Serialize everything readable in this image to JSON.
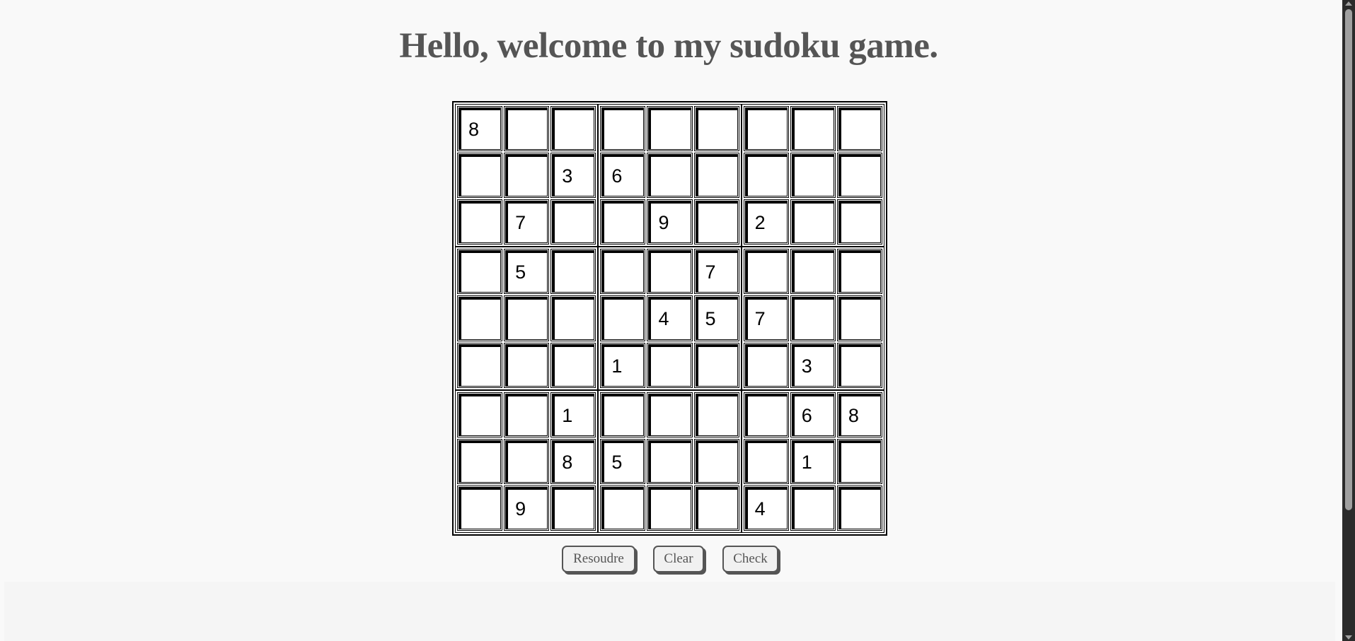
{
  "title": "Hello, welcome to my sudoku game.",
  "grid": [
    [
      "8",
      "",
      "",
      "",
      "",
      "",
      "",
      "",
      ""
    ],
    [
      "",
      "",
      "3",
      "6",
      "",
      "",
      "",
      "",
      ""
    ],
    [
      "",
      "7",
      "",
      "",
      "9",
      "",
      "2",
      "",
      ""
    ],
    [
      "",
      "5",
      "",
      "",
      "",
      "7",
      "",
      "",
      ""
    ],
    [
      "",
      "",
      "",
      "",
      "4",
      "5",
      "7",
      "",
      ""
    ],
    [
      "",
      "",
      "",
      "1",
      "",
      "",
      "",
      "3",
      ""
    ],
    [
      "",
      "",
      "1",
      "",
      "",
      "",
      "",
      "6",
      "8"
    ],
    [
      "",
      "",
      "8",
      "5",
      "",
      "",
      "",
      "1",
      ""
    ],
    [
      "",
      "9",
      "",
      "",
      "",
      "",
      "4",
      "",
      ""
    ]
  ],
  "buttons": {
    "solve": "Resoudre",
    "clear": "Clear",
    "check": "Check"
  }
}
